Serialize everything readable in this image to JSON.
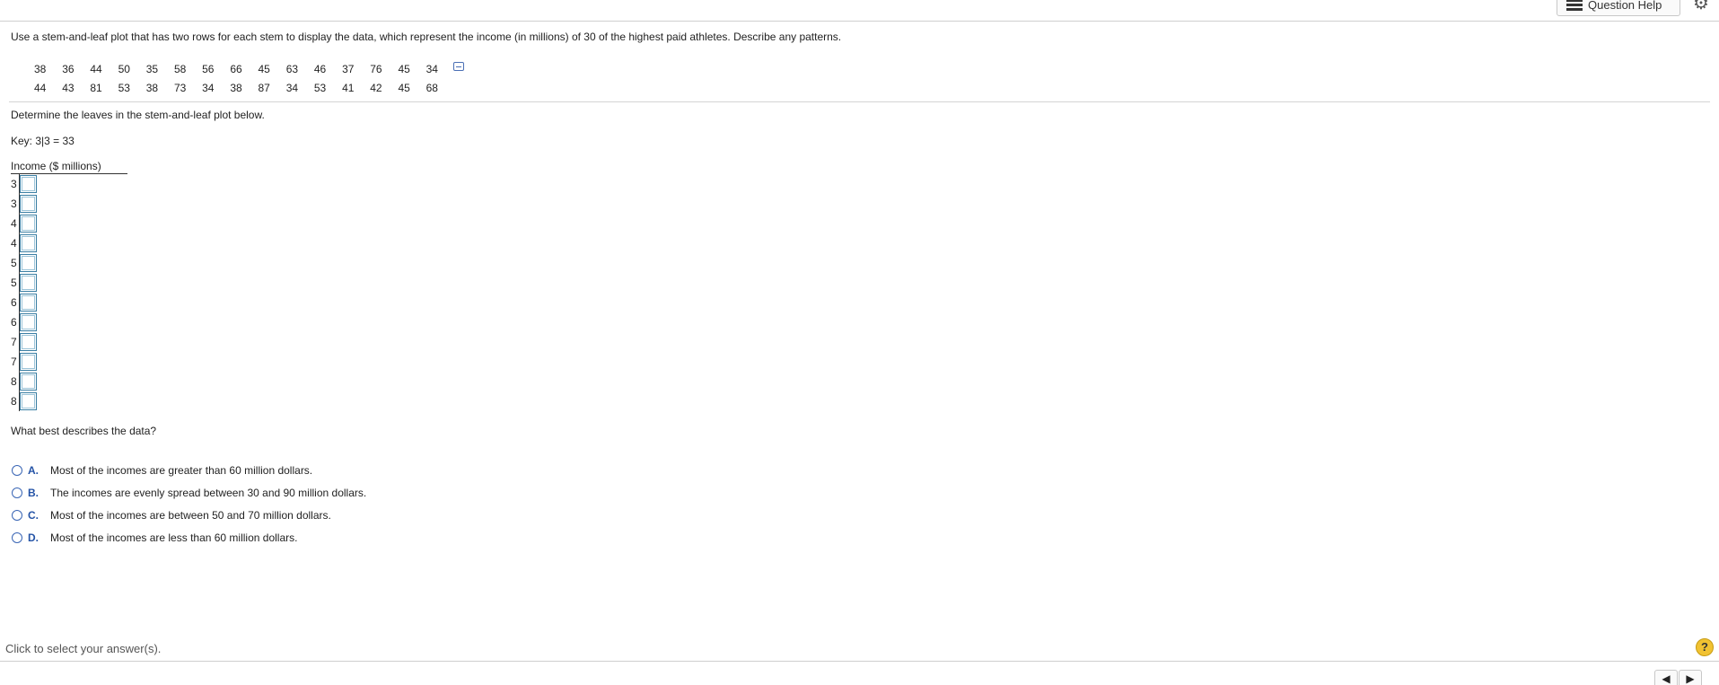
{
  "header": {
    "question_help_label": "Question Help",
    "list_icon": "list-icon",
    "gear_icon": "gear-icon"
  },
  "question": {
    "text": "Use a stem-and-leaf plot that has two rows for each stem to display the data, which represent the income (in millions) of 30 of the highest paid athletes. Describe any patterns.",
    "data_rows": [
      [
        "38",
        "36",
        "44",
        "50",
        "35",
        "58",
        "56",
        "66",
        "45",
        "63",
        "46",
        "37",
        "76",
        "45",
        "34"
      ],
      [
        "44",
        "43",
        "81",
        "53",
        "38",
        "73",
        "34",
        "38",
        "87",
        "34",
        "53",
        "41",
        "42",
        "45",
        "68"
      ]
    ],
    "popup_icon": "popup-icon"
  },
  "plot": {
    "instruction": "Determine the leaves in the stem-and-leaf plot below.",
    "key": "Key: 3|3 = 33",
    "title": "Income ($ millions)",
    "stems": [
      "3",
      "3",
      "4",
      "4",
      "5",
      "5",
      "6",
      "6",
      "7",
      "7",
      "8",
      "8"
    ],
    "leaves": [
      "",
      "",
      "",
      "",
      "",
      "",
      "",
      "",
      "",
      "",
      "",
      ""
    ]
  },
  "mc": {
    "prompt": "What best describes the data?",
    "options": [
      {
        "letter": "A.",
        "text": "Most of the incomes are greater than 60 million dollars."
      },
      {
        "letter": "B.",
        "text": "The incomes are evenly spread between 30 and 90 million dollars."
      },
      {
        "letter": "C.",
        "text": "Most of the incomes are between 50 and 70 million dollars."
      },
      {
        "letter": "D.",
        "text": "Most of the incomes are less than 60 million dollars."
      }
    ]
  },
  "footer": {
    "status": "Click to select your answer(s).",
    "help_glyph": "?",
    "prev_glyph": "◀",
    "next_glyph": "▶"
  },
  "colors": {
    "accent": "#2453a6",
    "input_border": "#3a7ea3",
    "help_bg": "#f1c232"
  }
}
